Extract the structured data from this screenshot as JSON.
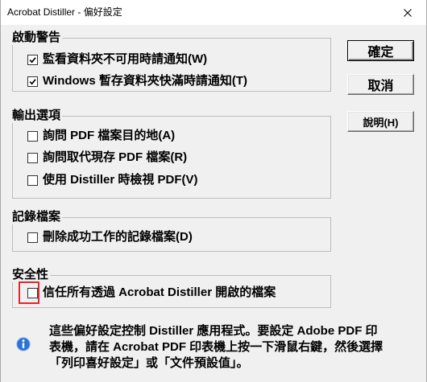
{
  "window": {
    "title": "Acrobat Distiller - 偏好設定"
  },
  "groups": [
    {
      "title": "啟動警告",
      "items": [
        {
          "label": "監看資料夾不可用時請通知(W)",
          "checked": true
        },
        {
          "label": "Windows 暫存資料夾快滿時請通知(T)",
          "checked": true
        }
      ]
    },
    {
      "title": "輸出選項",
      "items": [
        {
          "label": "詢問 PDF 檔案目的地(A)",
          "checked": false
        },
        {
          "label": "詢問取代現存 PDF 檔案(R)",
          "checked": false
        },
        {
          "label": "使用 Distiller 時檢視 PDF(V)",
          "checked": false
        }
      ]
    },
    {
      "title": "記錄檔案",
      "items": [
        {
          "label": "刪除成功工作的記錄檔案(D)",
          "checked": false
        }
      ]
    },
    {
      "title": "安全性",
      "items": [
        {
          "label": "信任所有透過 Acrobat Distiller 開啟的檔案",
          "checked": false
        }
      ]
    }
  ],
  "buttons": {
    "ok": "確定",
    "cancel": "取消",
    "help": "說明(H)"
  },
  "info": {
    "lines": [
      "這些偏好設定控制 Distiller 應用程式。要設定 Adobe PDF 印",
      "表機，請在 Acrobat PDF 印表機上按一下滑鼠右鍵，然後選擇",
      "「列印喜好設定」或「文件預設值」。"
    ]
  },
  "icons": {
    "close": "close-icon",
    "check": "checkmark-icon",
    "info": "info-icon"
  },
  "colors": {
    "dialog_bg": "#f0f0f0",
    "title_bg": "#ffffff",
    "highlight": "#e0282c",
    "info_icon": "#2a73d4",
    "text": "#000000"
  }
}
